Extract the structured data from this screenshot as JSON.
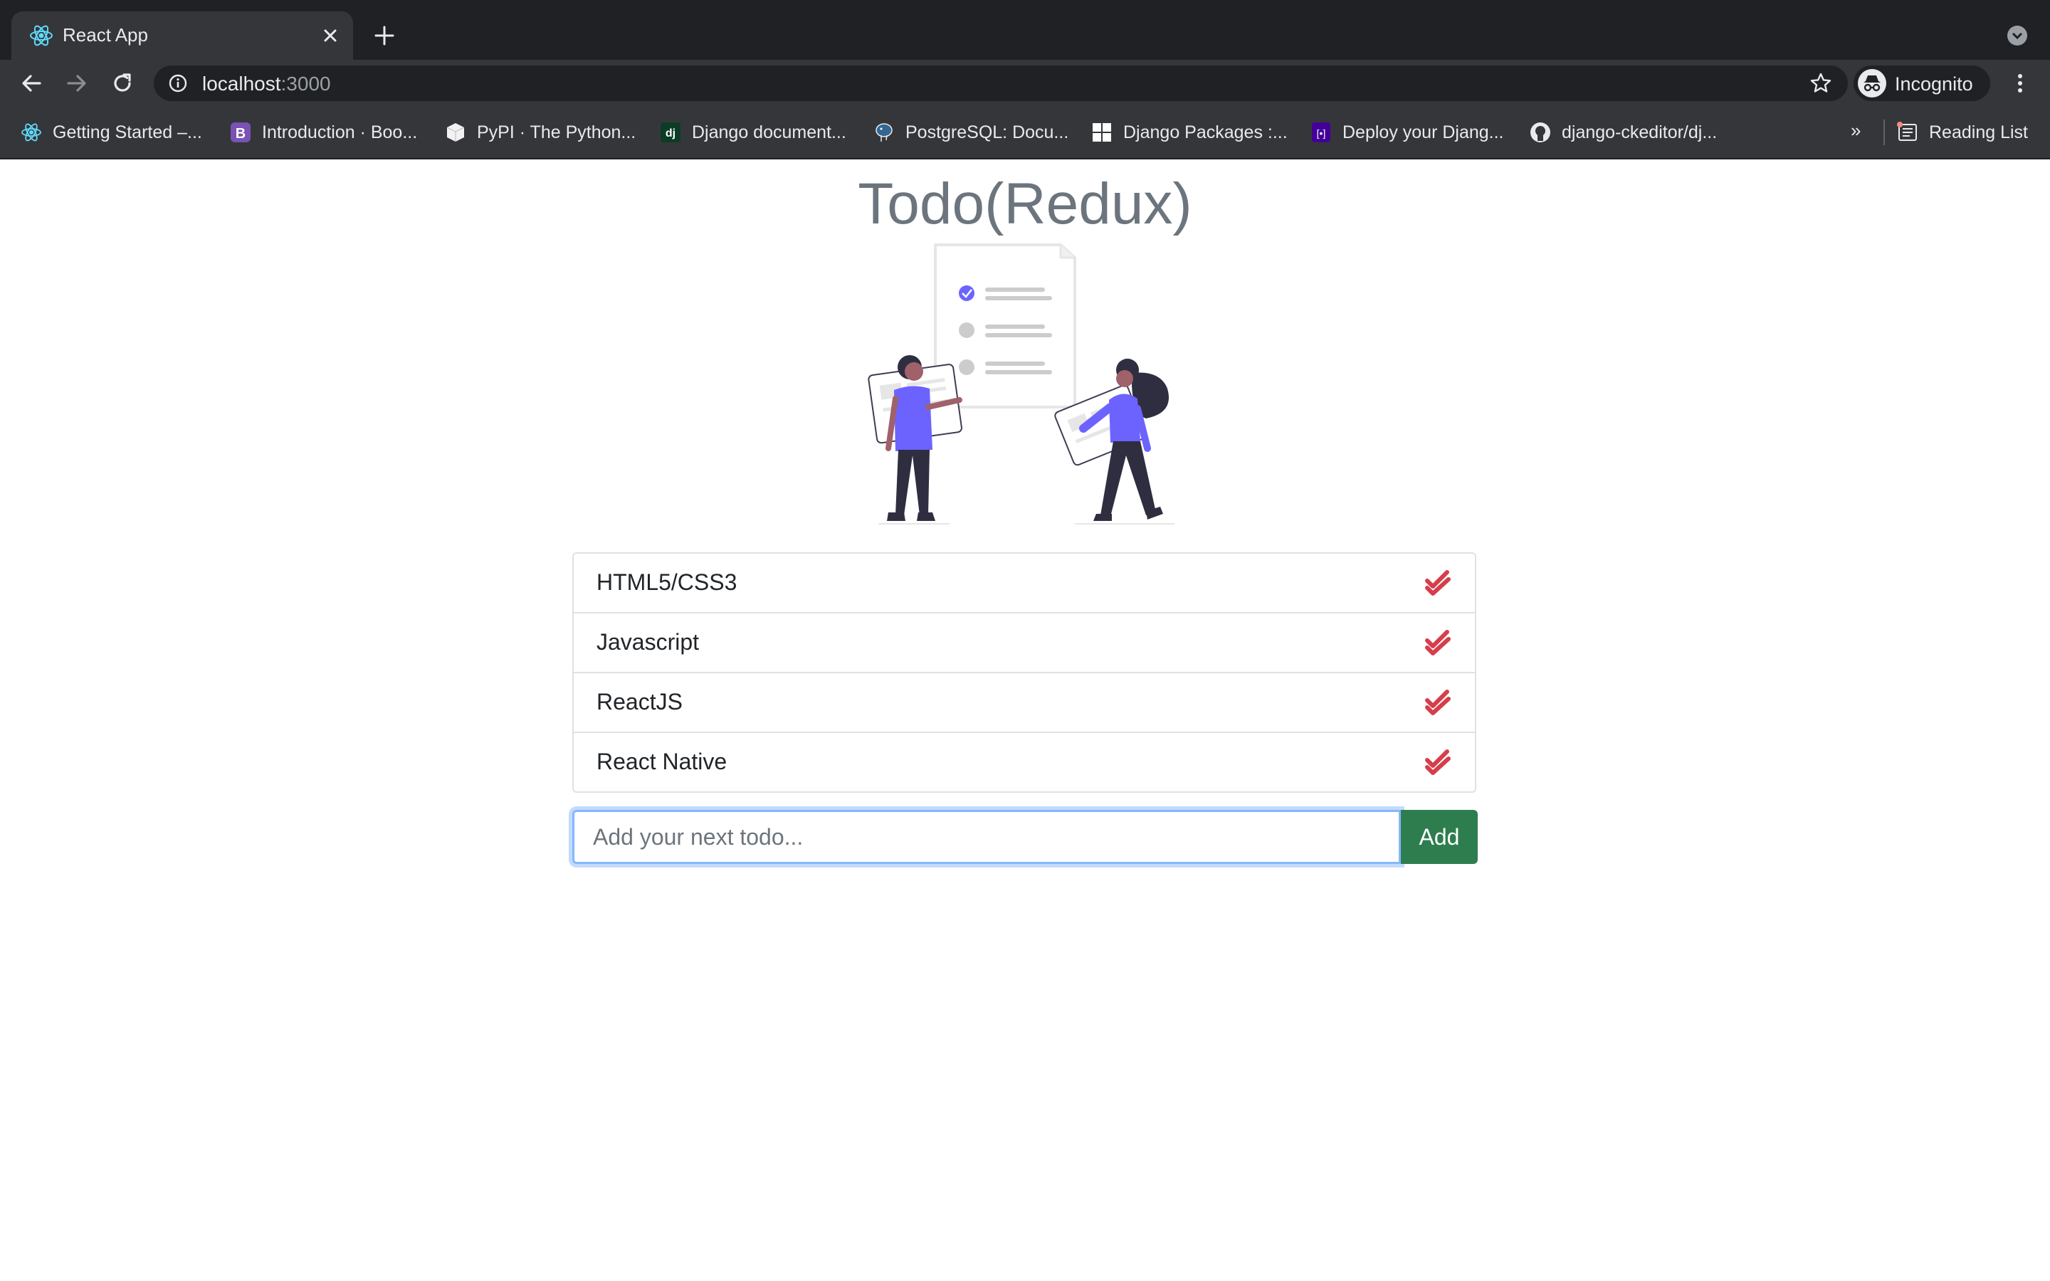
{
  "browser": {
    "tab": {
      "title": "React App"
    },
    "address": {
      "host": "localhost",
      "port": ":3000"
    },
    "profile_label": "Incognito",
    "bookmarks": [
      {
        "label": "Getting Started –...",
        "icon": "react-icon"
      },
      {
        "label": "Introduction · Boo...",
        "icon": "bootstrap-icon"
      },
      {
        "label": "PyPI · The Python...",
        "icon": "pypi-icon"
      },
      {
        "label": "Django document...",
        "icon": "django-icon"
      },
      {
        "label": "PostgreSQL: Docu...",
        "icon": "postgresql-icon"
      },
      {
        "label": "Django Packages :...",
        "icon": "django-packages-icon"
      },
      {
        "label": "Deploy your Djang...",
        "icon": "heroku-icon"
      },
      {
        "label": "django-ckeditor/dj...",
        "icon": "github-icon"
      }
    ],
    "bookmarks_overflow": "»",
    "reading_list": "Reading List"
  },
  "app": {
    "title": "Todo(Redux)",
    "todos": [
      {
        "text": "HTML5/CSS3"
      },
      {
        "text": "Javascript"
      },
      {
        "text": "ReactJS"
      },
      {
        "text": "React Native"
      }
    ],
    "input": {
      "placeholder": "Add your next todo...",
      "value": ""
    },
    "add_label": "Add"
  },
  "colors": {
    "accent_green": "#2e7d4f",
    "check_red": "#d63e4b",
    "illustration_purple": "#6c63ff"
  }
}
